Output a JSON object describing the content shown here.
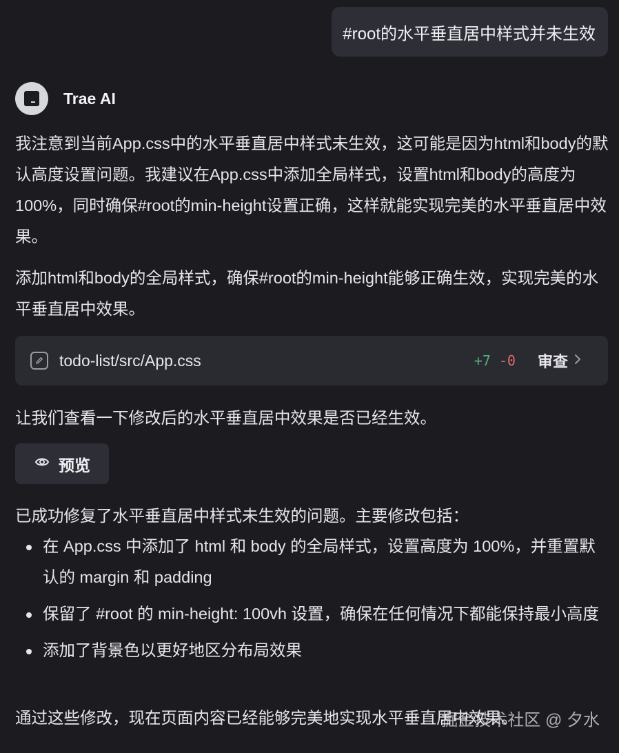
{
  "user_message": "#root的水平垂直居中样式并未生效",
  "assistant": {
    "name": "Trae AI",
    "intro": "我注意到当前App.css中的水平垂直居中样式未生效，这可能是因为html和body的默认高度设置问题。我建议在App.css中添加全局样式，设置html和body的高度为100%，同时确保#root的min-height设置正确，这样就能实现完美的水平垂直居中效果。",
    "action": "添加html和body的全局样式，确保#root的min-height能够正确生效，实现完美的水平垂直居中效果。",
    "file_change": {
      "path": "todo-list/src/App.css",
      "additions": "+7",
      "deletions": "-0",
      "review_label": "审查"
    },
    "check_text": "让我们查看一下修改后的水平垂直居中效果是否已经生效。",
    "preview_label": "预览",
    "summary_intro": "已成功修复了水平垂直居中样式未生效的问题。主要修改包括：",
    "summary_items": [
      "在 App.css 中添加了 html 和 body 的全局样式，设置高度为 100%，并重置默认的 margin 和 padding",
      "保留了 #root 的 min-height: 100vh 设置，确保在任何情况下都能保持最小高度",
      "添加了背景色以更好地区分布局效果"
    ],
    "conclusion": "通过这些修改，现在页面内容已经能够完美地实现水平垂直居中效果。"
  },
  "watermark": "掘金技术社区 @ 夕水",
  "colors": {
    "background": "#1c1c20",
    "user_bubble": "#2e2f36",
    "card": "#2a2b31",
    "diff_add": "#4fb07c",
    "diff_del": "#e0676d"
  }
}
